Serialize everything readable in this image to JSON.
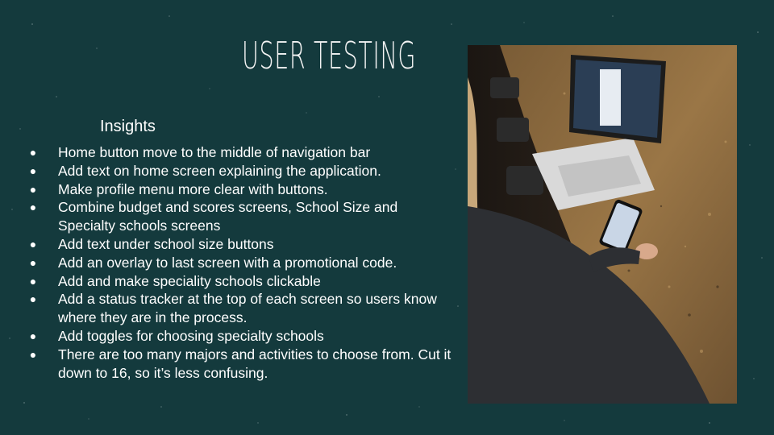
{
  "slide": {
    "title": "USER TESTING",
    "subtitle": "Insights",
    "bullet_glyph": "●",
    "bullets": [
      "Home button move to the middle of navigation bar",
      "Add text on home screen explaining the application.",
      "Make profile menu more clear with buttons.",
      "Combine budget and scores screens, School Size and Specialty schools screens",
      "Add text under school size buttons",
      "Add an overlay to last screen with a promotional code.",
      "Add and make speciality schools clickable",
      "Add a status tracker at the top of each screen so users know where they are in the process.",
      "Add toggles for choosing specialty schools",
      "There are too many majors and activities to choose from. Cut it down to 16, so it’s less confusing."
    ]
  },
  "colors": {
    "background": "#143a3d",
    "text": "#ffffff",
    "countertop": "#8a6a3e"
  }
}
